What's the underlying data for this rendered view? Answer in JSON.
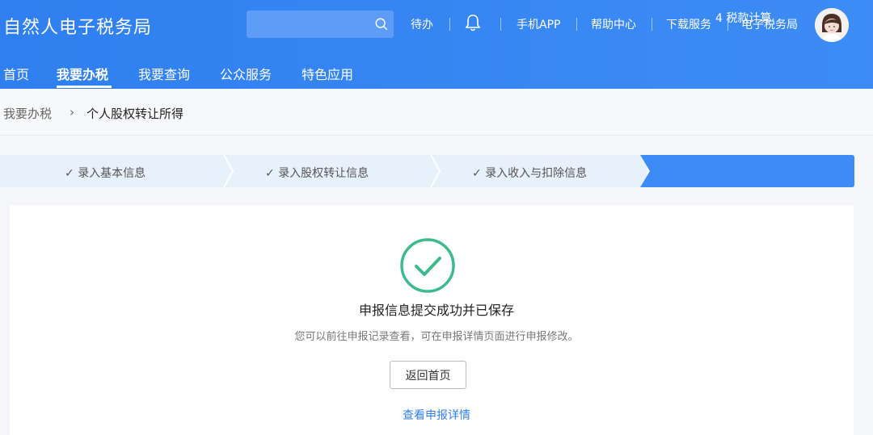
{
  "header": {
    "brand": "自然人电子税务局",
    "search": {
      "placeholder": ""
    },
    "links": {
      "todo": "待办",
      "app": "手机APP",
      "help": "帮助中心",
      "download": "下载服务",
      "bureau": "电子税务局"
    }
  },
  "nav": {
    "items": [
      "首页",
      "我要办税",
      "我要查询",
      "公众服务",
      "特色应用"
    ],
    "active_index": 1
  },
  "breadcrumb": {
    "parent": "我要办税",
    "separator": "›",
    "current": "个人股权转让所得"
  },
  "steps": [
    {
      "label": "录入基本信息",
      "done": true
    },
    {
      "label": "录入股权转让信息",
      "done": true
    },
    {
      "label": "录入收入与扣除信息",
      "done": true
    },
    {
      "label": "4 税款计算",
      "done": false,
      "active": true
    }
  ],
  "result": {
    "title": "申报信息提交成功并已保存",
    "description": "您可以前往申报记录查看，可在申报详情页面进行申报修改。",
    "home_button": "返回首页",
    "detail_link": "查看申报详情"
  },
  "colors": {
    "brand_blue": "#3d8cf5",
    "success_green": "#3dbb8a",
    "step_bg": "#e7f1fc"
  },
  "icons": [
    "search-icon",
    "bell-icon",
    "avatar",
    "check-icon",
    "success-check-icon"
  ]
}
